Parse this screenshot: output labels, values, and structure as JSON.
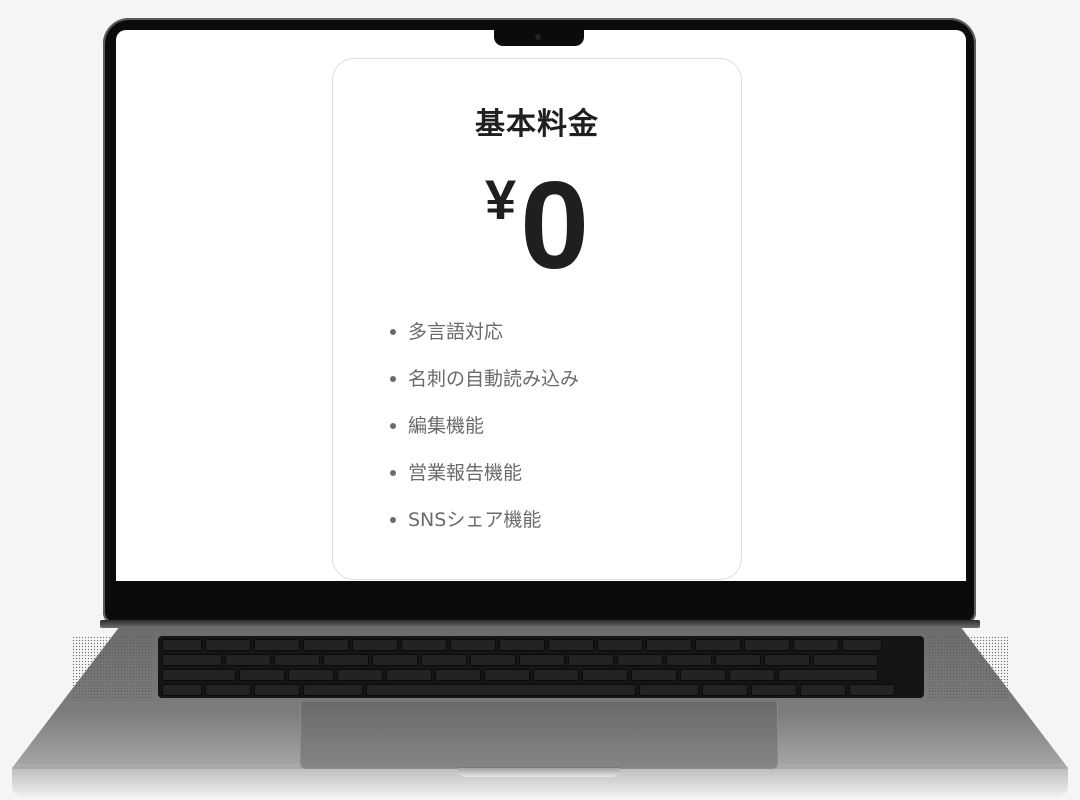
{
  "pricing_card": {
    "title": "基本料金",
    "currency_symbol": "¥",
    "price": "0",
    "features": [
      {
        "label": "多言語対応"
      },
      {
        "label": "名刺の自動読み込み"
      },
      {
        "label": "編集機能"
      },
      {
        "label": "営業報告機能"
      },
      {
        "label": "SNSシェア機能"
      }
    ]
  },
  "colors": {
    "background": "#f5f5f5",
    "card_border": "#dedede",
    "title_text": "#1f1f1f",
    "feature_text": "#6b6b6b",
    "bezel": "#0b0b0b",
    "body_metal": "#8a8a8a"
  }
}
